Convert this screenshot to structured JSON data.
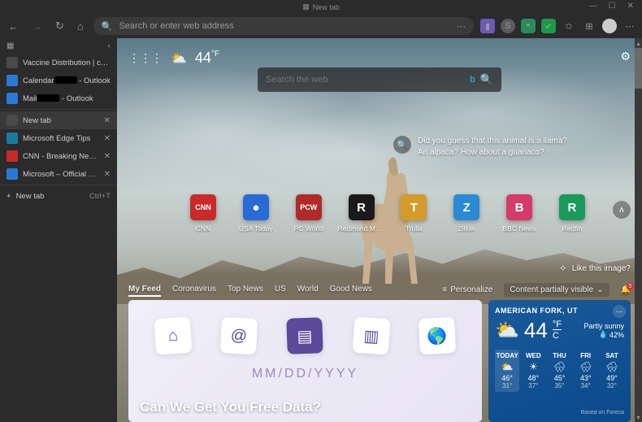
{
  "window": {
    "title": "New tab"
  },
  "toolbar": {
    "address_placeholder": "Search or enter web address"
  },
  "sidebar": {
    "items": [
      {
        "label": "Vaccine Distribution | coronavirus",
        "icon_bg": "#4a4a4a"
      },
      {
        "label": "Calendar",
        "suffix": "- Outlook",
        "icon_bg": "#2a7ad4",
        "redacted": true
      },
      {
        "label": "Mail",
        "suffix": "- Outlook",
        "icon_bg": "#2a7ad4",
        "redacted": true
      }
    ],
    "tabs": [
      {
        "label": "New tab",
        "icon_bg": "#4a4a4a",
        "selected": true
      },
      {
        "label": "Microsoft Edge Tips",
        "icon_bg": "#1a7a9a"
      },
      {
        "label": "CNN - Breaking News, Latest News",
        "icon_bg": "#c82a2a"
      },
      {
        "label": "Microsoft – Official Home Page",
        "icon_bg": "#2a7ad4"
      }
    ],
    "newtab": {
      "label": "New tab",
      "shortcut": "Ctrl+T"
    }
  },
  "ntp": {
    "temp": "44",
    "unit": "°F",
    "search_placeholder": "Search the web",
    "trivia": {
      "line1": "Did you guess that this animal is a llama?",
      "line2": "An alpaca? How about a guanaco?"
    },
    "like_label": "Like this image?",
    "quick": [
      {
        "label": "CNN",
        "glyph": "CNN",
        "bg": "#c82a2a",
        "fs": "9px"
      },
      {
        "label": "USA Today",
        "glyph": "●",
        "bg": "#2a6ad4"
      },
      {
        "label": "PC World",
        "glyph": "PCW",
        "bg": "#b02a2a",
        "fs": "9px"
      },
      {
        "label": "Redmond Ma...",
        "glyph": "R",
        "bg": "#1a1a1a"
      },
      {
        "label": "Trulia",
        "glyph": "T",
        "bg": "#d49a2a"
      },
      {
        "label": "Zillow",
        "glyph": "Z",
        "bg": "#2a8ad4"
      },
      {
        "label": "BBC News",
        "glyph": "B",
        "bg": "#d43a6a"
      },
      {
        "label": "Redfin",
        "glyph": "R",
        "bg": "#1a9a5a"
      }
    ],
    "tabs": [
      "My Feed",
      "Coronavirus",
      "Top News",
      "US",
      "World",
      "Good News"
    ],
    "personalize": "Personalize",
    "visibility": "Content partially visible",
    "bell_count": "5",
    "feed": {
      "placeholder": "MM/DD/YYYY",
      "headline": "Can We Get You Free Data?"
    },
    "weather": {
      "location": "AMERICAN FORK, UT",
      "temp": "44",
      "f": "°F",
      "c": "C",
      "desc": "Partly sunny",
      "precip": "42%",
      "days": [
        {
          "name": "TODAY",
          "icon": "⛅",
          "hi": "46°",
          "lo": "31°"
        },
        {
          "name": "WED",
          "icon": "☀",
          "hi": "48°",
          "lo": "37°"
        },
        {
          "name": "THU",
          "icon": "🌧",
          "hi": "45°",
          "lo": "35°"
        },
        {
          "name": "FRI",
          "icon": "🌧",
          "hi": "43°",
          "lo": "34°"
        },
        {
          "name": "SAT",
          "icon": "🌨",
          "hi": "49°",
          "lo": "32°"
        }
      ],
      "source": "Based on Foreca"
    }
  }
}
